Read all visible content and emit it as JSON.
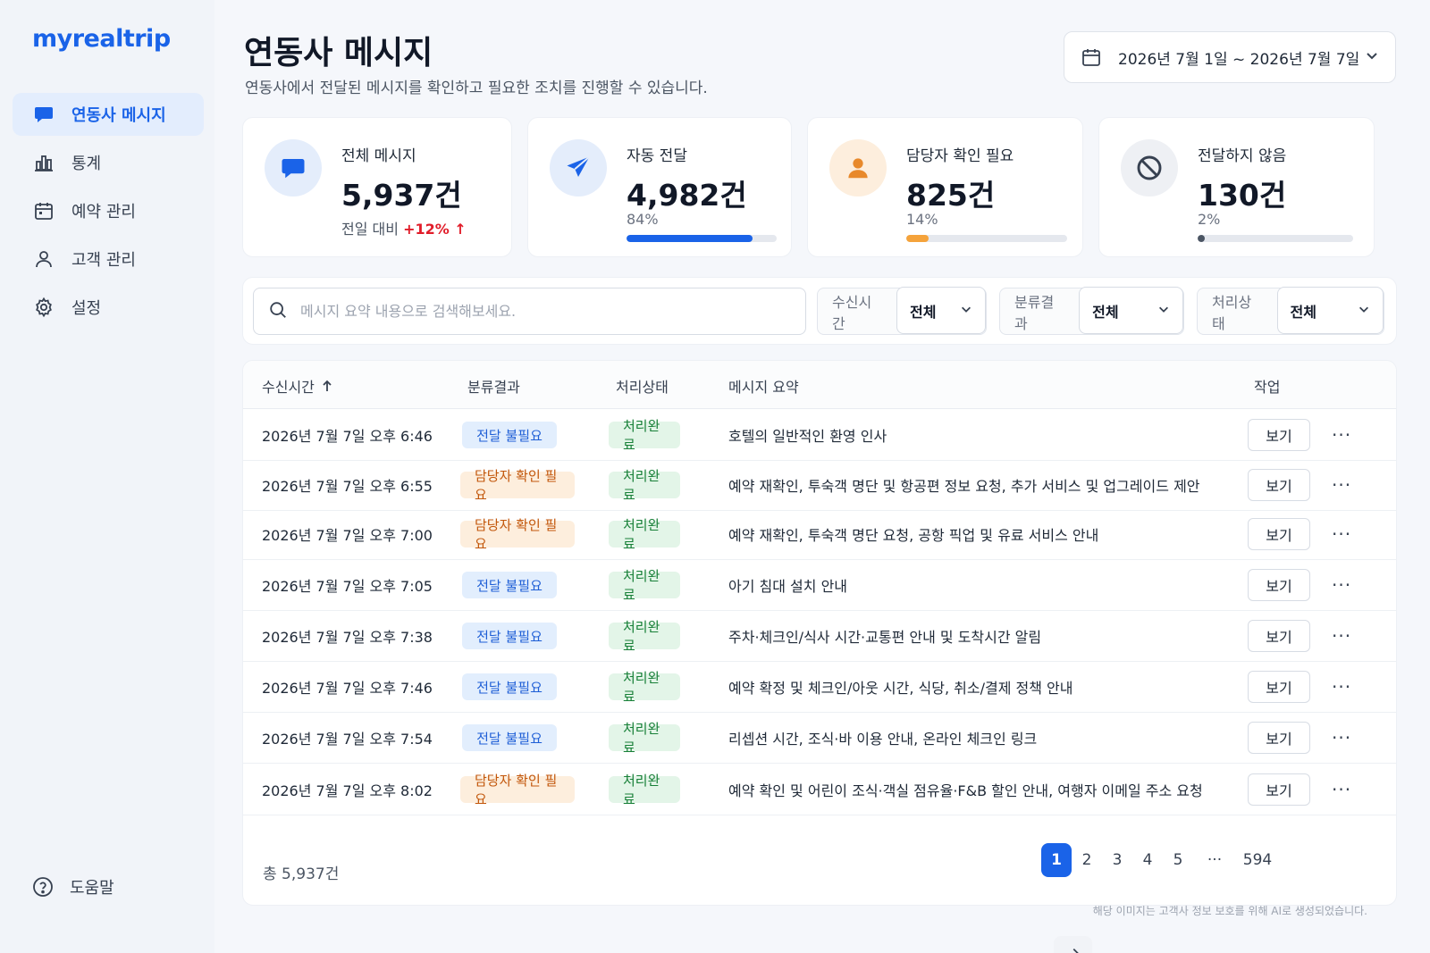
{
  "brand": "myrealtrip",
  "sidebar": {
    "items": [
      {
        "label": "연동사 메시지",
        "icon": "chat-icon",
        "active": true
      },
      {
        "label": "통계",
        "icon": "bar-chart-icon"
      },
      {
        "label": "예약 관리",
        "icon": "calendar-icon"
      },
      {
        "label": "고객 관리",
        "icon": "user-icon"
      },
      {
        "label": "설정",
        "icon": "gear-icon"
      }
    ],
    "help": "도움말"
  },
  "header": {
    "title": "연동사 메시지",
    "subtitle": "연동사에서 전달된 메시지를 확인하고 필요한 조치를 진행할 수 있습니다.",
    "date_range": "2026년 7월 1일 ~ 2026년 7월 7일"
  },
  "stats": [
    {
      "label": "전체 메시지",
      "value": "5,937건",
      "compare_prefix": "전일 대비",
      "compare_value": "+12% ↑",
      "icon": "chat-icon",
      "color": "#1a63e8"
    },
    {
      "label": "자동 전달",
      "value": "4,982건",
      "percent": "84%",
      "progress": 0.84,
      "icon": "send-icon",
      "color": "#1a63e8"
    },
    {
      "label": "담당자 확인 필요",
      "value": "825건",
      "percent": "14%",
      "progress": 0.14,
      "icon": "person-icon",
      "color": "#f5a33b"
    },
    {
      "label": "전달하지 않음",
      "value": "130건",
      "percent": "2%",
      "progress": 0.02,
      "icon": "block-icon",
      "color": "#4b5563"
    }
  ],
  "filters": {
    "search_placeholder": "메시지 요약 내용으로 검색해보세요.",
    "received": {
      "label": "수신시간",
      "value": "전체"
    },
    "classification": {
      "label": "분류결과",
      "value": "전체"
    },
    "status": {
      "label": "처리상태",
      "value": "전체"
    }
  },
  "table": {
    "headers": {
      "time": "수신시간",
      "class": "분류결과",
      "status": "처리상태",
      "summary": "메시지 요약",
      "action": "작업"
    },
    "rows": [
      {
        "time": "2026년 7월 7일 오후 6:46",
        "class": "전달 불필요",
        "status": "처리완료",
        "summary": "호텔의 일반적인 환영 인사",
        "action": "보기"
      },
      {
        "time": "2026년 7월 7일 오후 6:55",
        "class": "담당자 확인 필요",
        "status": "처리완료",
        "summary": "예약 재확인, 투숙객 명단 및 항공편 정보 요청, 추가 서비스 및 업그레이드 제안",
        "action": "보기"
      },
      {
        "time": "2026년 7월 7일 오후 7:00",
        "class": "담당자 확인 필요",
        "status": "처리완료",
        "summary": "예약 재확인, 투숙객 명단 요청, 공항 픽업 및 유료 서비스 안내",
        "action": "보기"
      },
      {
        "time": "2026년 7월 7일 오후 7:05",
        "class": "전달 불필요",
        "status": "처리완료",
        "summary": "아기 침대 설치 안내",
        "action": "보기"
      },
      {
        "time": "2026년 7월 7일 오후 7:38",
        "class": "전달 불필요",
        "status": "처리완료",
        "summary": "주차·체크인/식사 시간·교통편 안내 및 도착시간 알림",
        "action": "보기"
      },
      {
        "time": "2026년 7월 7일 오후 7:46",
        "class": "전달 불필요",
        "status": "처리완료",
        "summary": "예약 확정 및 체크인/아웃 시간, 식당, 취소/결제 정책 안내",
        "action": "보기"
      },
      {
        "time": "2026년 7월 7일 오후 7:54",
        "class": "전달 불필요",
        "status": "처리완료",
        "summary": "리셉션 시간, 조식·바 이용 안내, 온라인 체크인 링크",
        "action": "보기"
      },
      {
        "time": "2026년 7월 7일 오후 8:02",
        "class": "담당자 확인 필요",
        "status": "처리완료",
        "summary": "예약 확인 및 어린이 조식·객실 점유율·F&B 할인 안내, 여행자 이메일 주소 요청",
        "action": "보기"
      }
    ]
  },
  "pagination": {
    "total": "총 5,937건",
    "pages": [
      "1",
      "2",
      "3",
      "4",
      "5",
      "···",
      "594"
    ],
    "current": "1"
  },
  "footnote": "해당 이미지는 고객사 정보 보호를 위해 AI로 생성되었습니다."
}
